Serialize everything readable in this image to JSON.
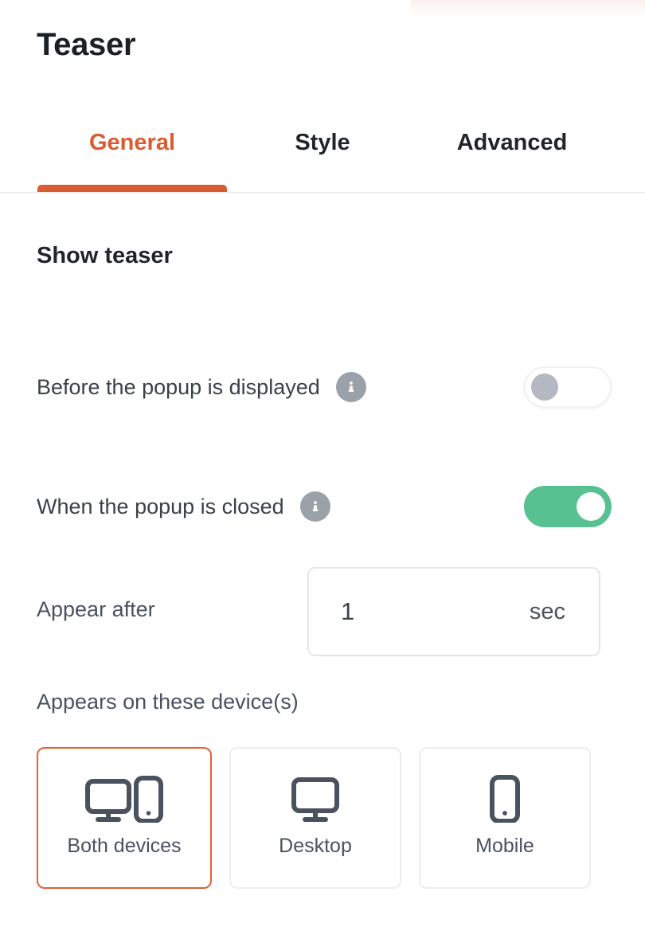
{
  "header": {
    "title": "Teaser"
  },
  "tabs": [
    {
      "label": "General",
      "active": true
    },
    {
      "label": "Style",
      "active": false
    },
    {
      "label": "Advanced",
      "active": false
    }
  ],
  "section": {
    "title": "Show teaser"
  },
  "settings": [
    {
      "label": "Before the popup is displayed",
      "info_icon": "info-icon",
      "toggle_state": "off"
    },
    {
      "label": "When the popup is closed",
      "info_icon": "info-icon",
      "toggle_state": "on"
    }
  ],
  "appear_after": {
    "label": "Appear after",
    "value": "1",
    "unit": "sec"
  },
  "devices": {
    "label": "Appears on these device(s)",
    "options": [
      {
        "label": "Both devices",
        "icon": "monitor-and-phone-icon",
        "selected": true
      },
      {
        "label": "Desktop",
        "icon": "monitor-icon",
        "selected": false
      },
      {
        "label": "Mobile",
        "icon": "phone-icon",
        "selected": false
      }
    ]
  },
  "colors": {
    "accent_orange": "#d95b31",
    "toggle_on_green": "#57c191",
    "toggle_off_knob": "#b3b8c2",
    "info_icon_grey": "#9ba1a9",
    "text_dark": "#21252b",
    "text_muted": "#4a5260",
    "border_light": "#ebedf0"
  }
}
